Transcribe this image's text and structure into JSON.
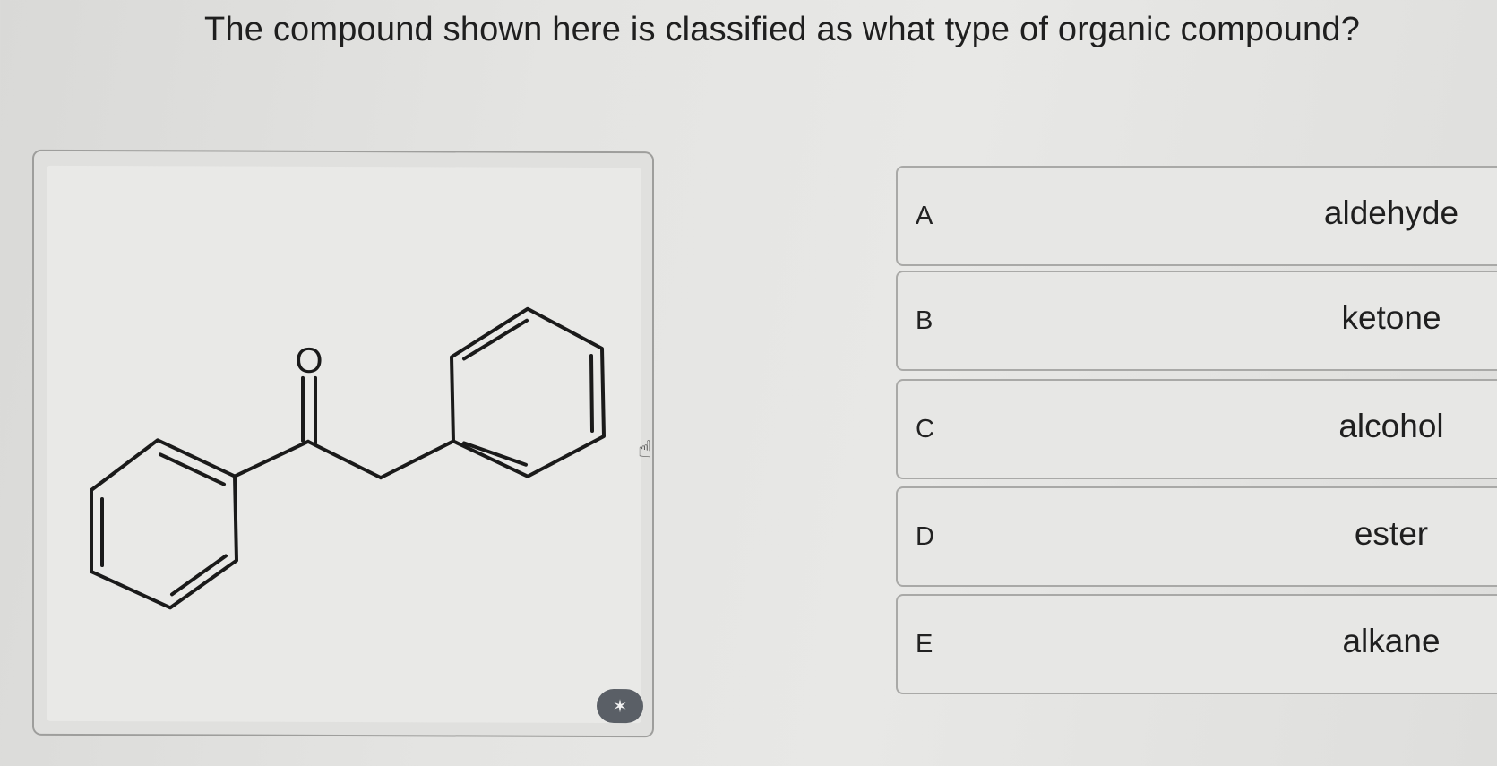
{
  "question": {
    "text": "The compound shown here is classified as what type of organic compound?"
  },
  "figure": {
    "oxygen_label": "O",
    "cursor_icon": "hand-pointer-icon",
    "edit_button_icon": "magic-wand-icon"
  },
  "options": [
    {
      "letter": "A",
      "text": "aldehyde"
    },
    {
      "letter": "B",
      "text": "ketone"
    },
    {
      "letter": "C",
      "text": "alcohol"
    },
    {
      "letter": "D",
      "text": "ester"
    },
    {
      "letter": "E",
      "text": "alkane"
    }
  ]
}
